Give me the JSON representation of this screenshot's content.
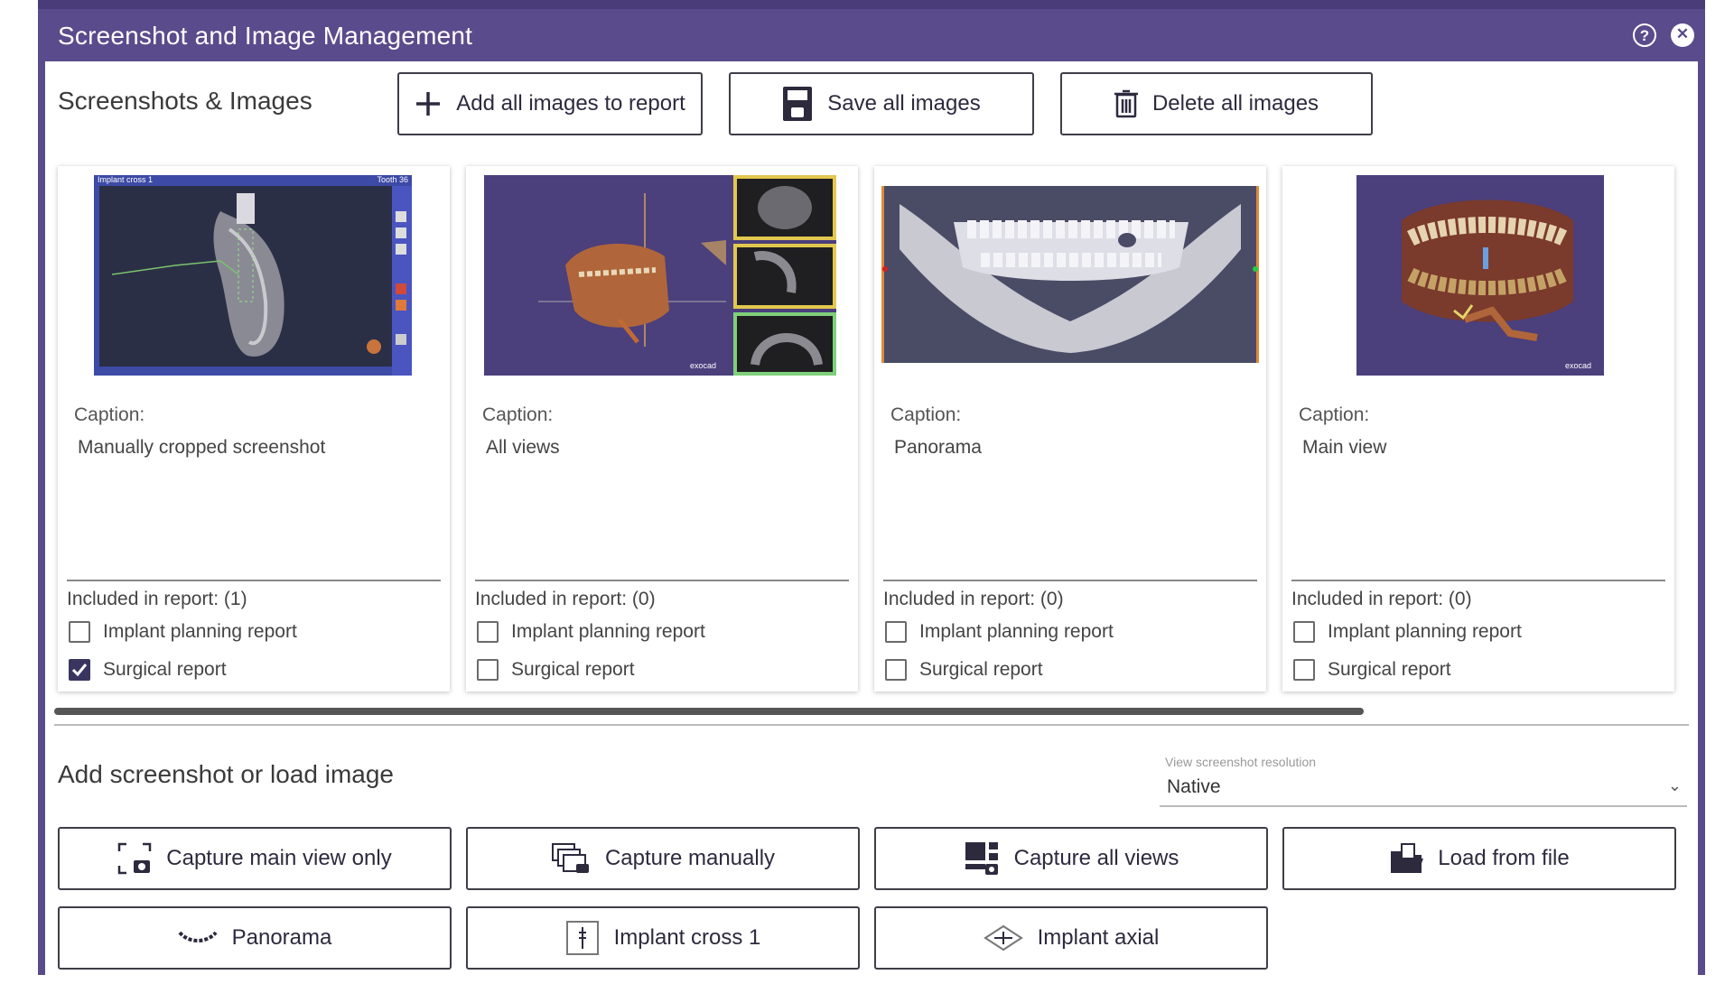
{
  "window": {
    "title": "Screenshot and Image Management"
  },
  "header": {
    "section_title": "Screenshots & Images",
    "add_all_label": "Add all images to report",
    "save_all_label": "Save all images",
    "delete_all_label": "Delete all images"
  },
  "cards": [
    {
      "thumb_kind": "implant-cross",
      "thumb_title": "Implant cross 1",
      "thumb_tooth": "Tooth 36",
      "caption_label": "Caption:",
      "caption": "Manually cropped screenshot",
      "included": "Included in report: (1)",
      "implant_label": "Implant planning report",
      "implant_checked": false,
      "surgical_label": "Surgical report",
      "surgical_checked": true
    },
    {
      "thumb_kind": "all-views",
      "thumb_brand": "exocad",
      "caption_label": "Caption:",
      "caption": "All views",
      "included": "Included in report: (0)",
      "implant_label": "Implant planning report",
      "implant_checked": false,
      "surgical_label": "Surgical report",
      "surgical_checked": false
    },
    {
      "thumb_kind": "panorama",
      "caption_label": "Caption:",
      "caption": "Panorama",
      "included": "Included in report: (0)",
      "implant_label": "Implant planning report",
      "implant_checked": false,
      "surgical_label": "Surgical report",
      "surgical_checked": false
    },
    {
      "thumb_kind": "main-view",
      "thumb_brand": "exocad",
      "caption_label": "Caption:",
      "caption": "Main view",
      "included": "Included in report: (0)",
      "implant_label": "Implant planning report",
      "implant_checked": false,
      "surgical_label": "Surgical report",
      "surgical_checked": false
    }
  ],
  "add_section": {
    "title": "Add screenshot or load image",
    "resolution_label": "View screenshot resolution",
    "resolution_value": "Native"
  },
  "capture_buttons": {
    "main_view": "Capture main view only",
    "manually": "Capture manually",
    "all_views": "Capture all views",
    "load_file": "Load from file",
    "panorama": "Panorama",
    "implant_cross": "Implant cross 1",
    "implant_axial": "Implant axial"
  },
  "colors": {
    "titlebar": "#5a4b8c",
    "thumb_bg": "#4b3f7c",
    "checked": "#3a3560"
  }
}
